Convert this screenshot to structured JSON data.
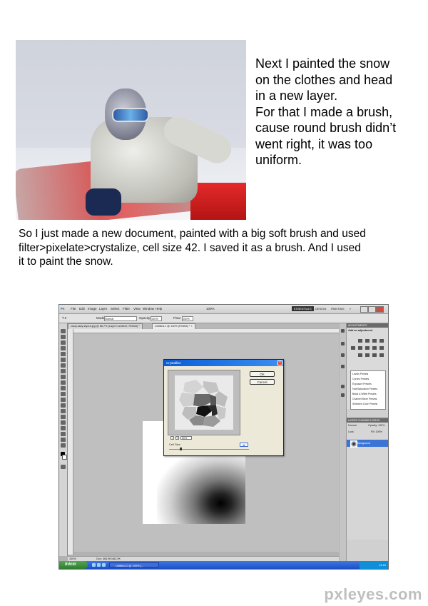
{
  "top_paragraph": [
    "Next I painted the snow",
    "on the clothes and head",
    "in a new layer.",
    "For that I made a brush,",
    "cause round brush didn’t",
    "went right, it was too",
    "uniform."
  ],
  "wide_paragraph": [
    "So I just made a new document, painted with a big soft brush and used",
    "filter>pixelate>crystalize, cell size 42. I saved it as a brush. And I used",
    "it to paint the snow."
  ],
  "photoshop": {
    "menu": [
      "Ps",
      "File",
      "Edit",
      "Image",
      "Layer",
      "Select",
      "Filter",
      "View",
      "Window",
      "Help"
    ],
    "zoom_menu": "100%",
    "workspace": {
      "essentials": "ESSENTIALS",
      "design": "DESIGN",
      "painting": "PAINTING",
      "more": "»"
    },
    "options": {
      "mode_label": "Mode:",
      "mode_value": "Normal",
      "opacity_label": "Opacity:",
      "opacity_value": "100%",
      "flow_label": "Flow:",
      "flow_value": "100%"
    },
    "tabs": [
      "crazy-lady-layout.jpg @ 66,7% (Layer number2, RGB/8) *",
      "Untitled-1 @ 100% (RGB/8) * ×"
    ],
    "status": {
      "zoom": "100%",
      "doc": "Doc: 463,9K/463,9K"
    },
    "adjustments": {
      "header": "ADJUSTMENTS",
      "subtitle": "Add an adjustment",
      "presets": [
        "Levels Presets",
        "Curves Presets",
        "Exposure Presets",
        "Hue/Saturation Presets",
        "Black & White Presets",
        "Channel Mixer Presets",
        "Selective Color Presets"
      ]
    },
    "layers": {
      "tabs": "LAYERS  CHANNELS  PATHS",
      "mode": "Normal",
      "opacity": "Opacity: 100%",
      "lock": "Lock:",
      "fill": "Fill: 100%",
      "layer_name": "Background"
    },
    "dialog": {
      "title": "Crystallize",
      "ok": "OK",
      "cancel": "Cancel",
      "zoom": "50%",
      "zoom_minus": "-",
      "zoom_plus": "+",
      "cell_label": "Cell Size",
      "cell_value": "42",
      "cell_min": 3,
      "cell_max": 300
    },
    "taskbar": {
      "start": "Inicio",
      "window": "Untitled-1 @ 100% (...",
      "time": "14:15"
    }
  },
  "watermark": "pxleyes.com"
}
